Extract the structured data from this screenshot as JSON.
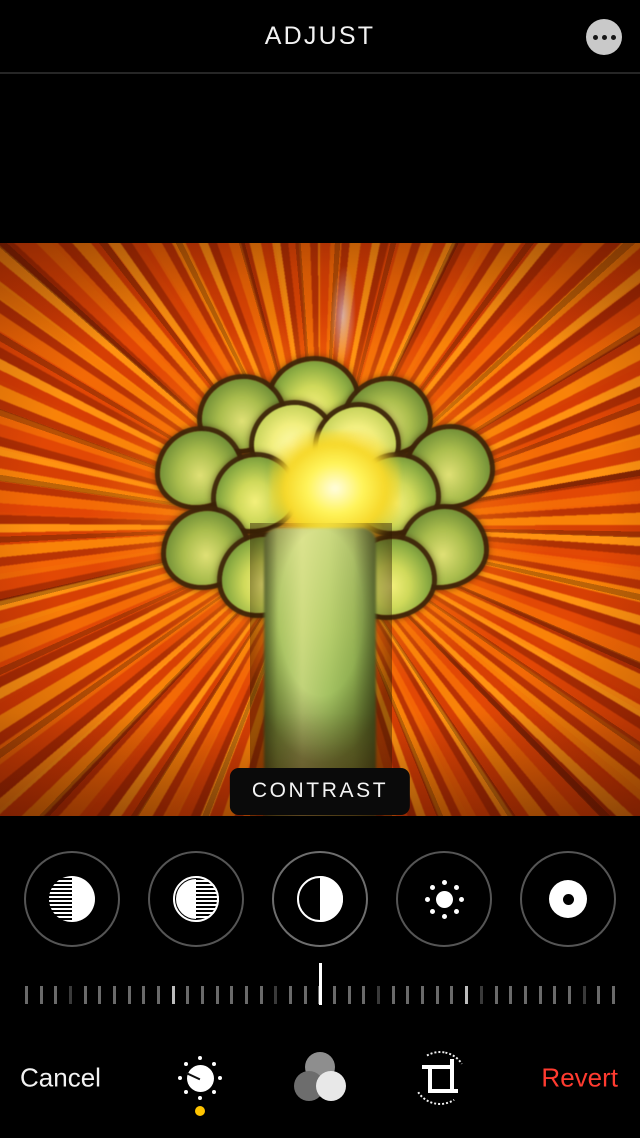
{
  "header": {
    "title": "ADJUST",
    "more_icon": "more-options-icon"
  },
  "photo": {
    "subject": "orange gerbera flower macro",
    "overlay_badge": "CONTRAST"
  },
  "adjust_tools": {
    "selected_index": 2,
    "items": [
      {
        "name": "shadows",
        "icon": "shadows-icon"
      },
      {
        "name": "brightness-point",
        "icon": "brightness-point-icon"
      },
      {
        "name": "contrast",
        "icon": "contrast-icon"
      },
      {
        "name": "brilliance",
        "icon": "sun-brightness-icon"
      },
      {
        "name": "black-point",
        "icon": "black-point-icon"
      }
    ]
  },
  "slider": {
    "value_position_percent": 50,
    "tick_count": 41,
    "bright_tick_indices": [
      10,
      30
    ]
  },
  "bottom_bar": {
    "cancel_label": "Cancel",
    "revert_label": "Revert",
    "revert_color": "#ff3b30",
    "active_indicator_color": "#ffc400",
    "tools": [
      {
        "name": "adjust",
        "icon": "adjust-dial-icon",
        "active": true
      },
      {
        "name": "filters",
        "icon": "filters-circles-icon",
        "active": false
      },
      {
        "name": "crop",
        "icon": "crop-rotate-icon",
        "active": false
      }
    ]
  }
}
